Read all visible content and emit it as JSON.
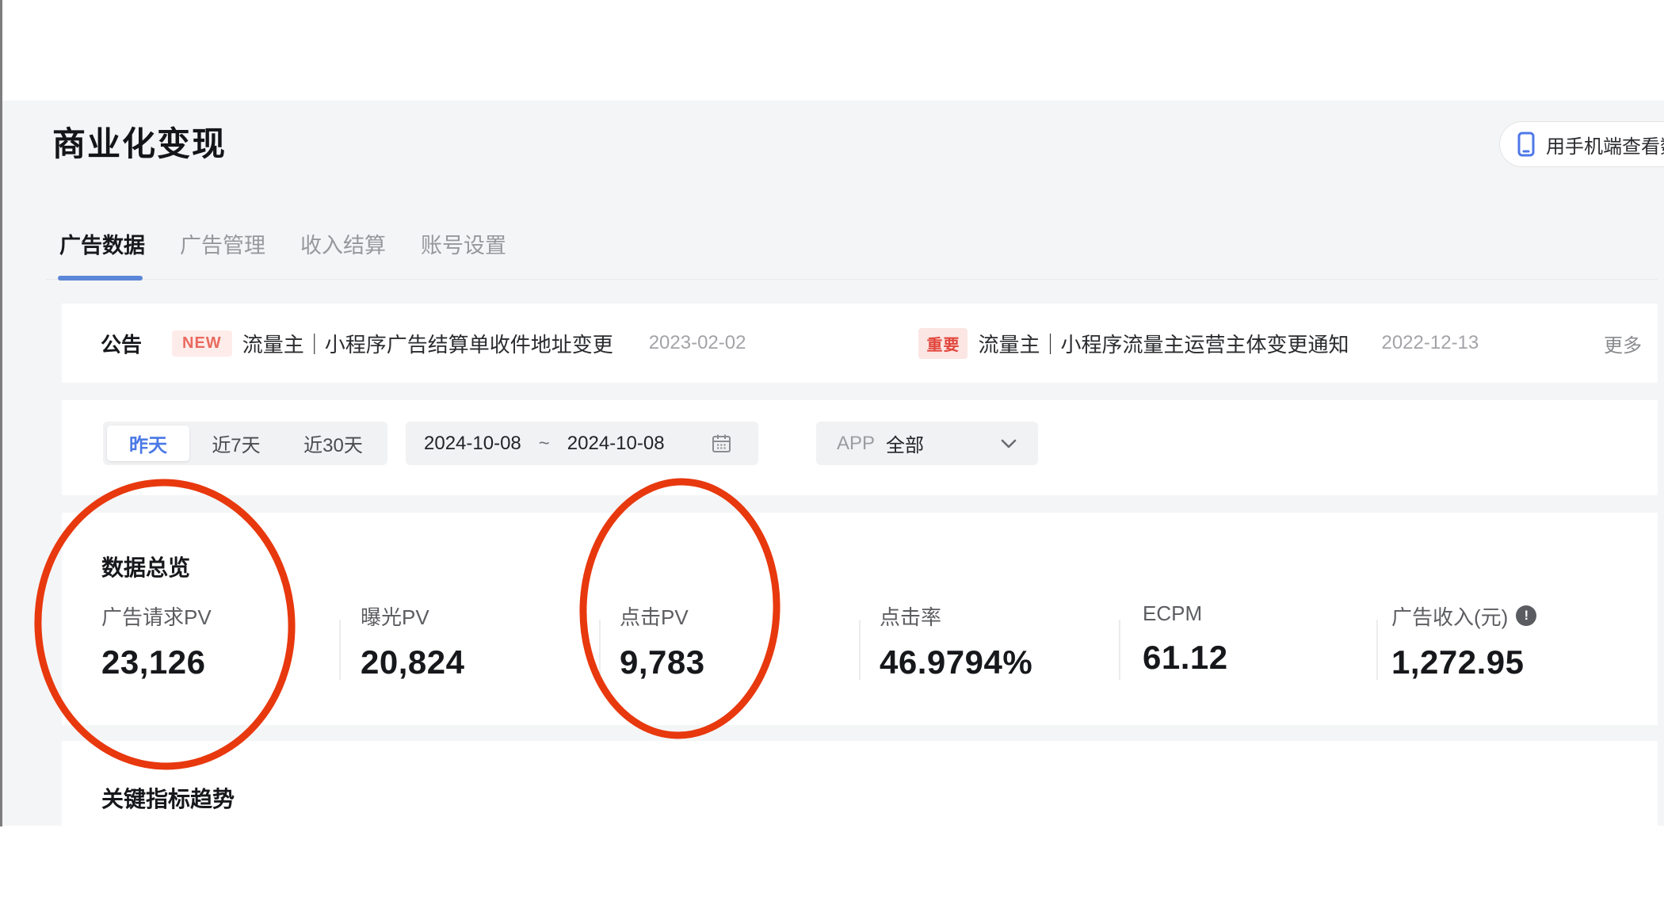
{
  "page": {
    "title": "商业化变现"
  },
  "header": {
    "mobile_view_button": "用手机端查看数据"
  },
  "tabs": {
    "items": [
      {
        "label": "广告数据",
        "active": true
      },
      {
        "label": "广告管理",
        "active": false
      },
      {
        "label": "收入结算",
        "active": false
      },
      {
        "label": "账号设置",
        "active": false
      }
    ]
  },
  "announcements": {
    "title": "公告",
    "more_label": "更多",
    "items": [
      {
        "badge": "NEW",
        "text": "流量主｜小程序广告结算单收件地址变更",
        "date": "2023-02-02"
      },
      {
        "badge": "重要",
        "text": "流量主｜小程序流量主运营主体变更通知",
        "date": "2022-12-13"
      }
    ]
  },
  "filters": {
    "quick_ranges": [
      {
        "label": "昨天",
        "selected": true
      },
      {
        "label": "近7天",
        "selected": false
      },
      {
        "label": "近30天",
        "selected": false
      }
    ],
    "date_range": {
      "start": "2024-10-08",
      "separator": "~",
      "end": "2024-10-08"
    },
    "app_select": {
      "label": "APP",
      "value": "全部"
    }
  },
  "overview": {
    "title": "数据总览",
    "metrics": [
      {
        "label": "广告请求PV",
        "value": "23,126"
      },
      {
        "label": "曝光PV",
        "value": "20,824"
      },
      {
        "label": "点击PV",
        "value": "9,783"
      },
      {
        "label": "点击率",
        "value": "46.9794%"
      },
      {
        "label": "ECPM",
        "value": "61.12"
      },
      {
        "label": "广告收入(元)",
        "value": "1,272.95",
        "info_badge": "!"
      }
    ]
  },
  "trend": {
    "title": "关键指标趋势"
  },
  "annotations": {
    "circled_metrics": [
      "广告请求PV",
      "点击PV"
    ]
  },
  "colors": {
    "accent_blue": "#5b87d8",
    "link_blue": "#4a79e6",
    "annotation_red": "#e8380e",
    "badge_new_text": "#e96a5e",
    "badge_new_bg": "#fdecea",
    "badge_important_text": "#e2463c",
    "badge_important_bg": "#fbe6e3",
    "page_bg": "#f4f5f6"
  }
}
